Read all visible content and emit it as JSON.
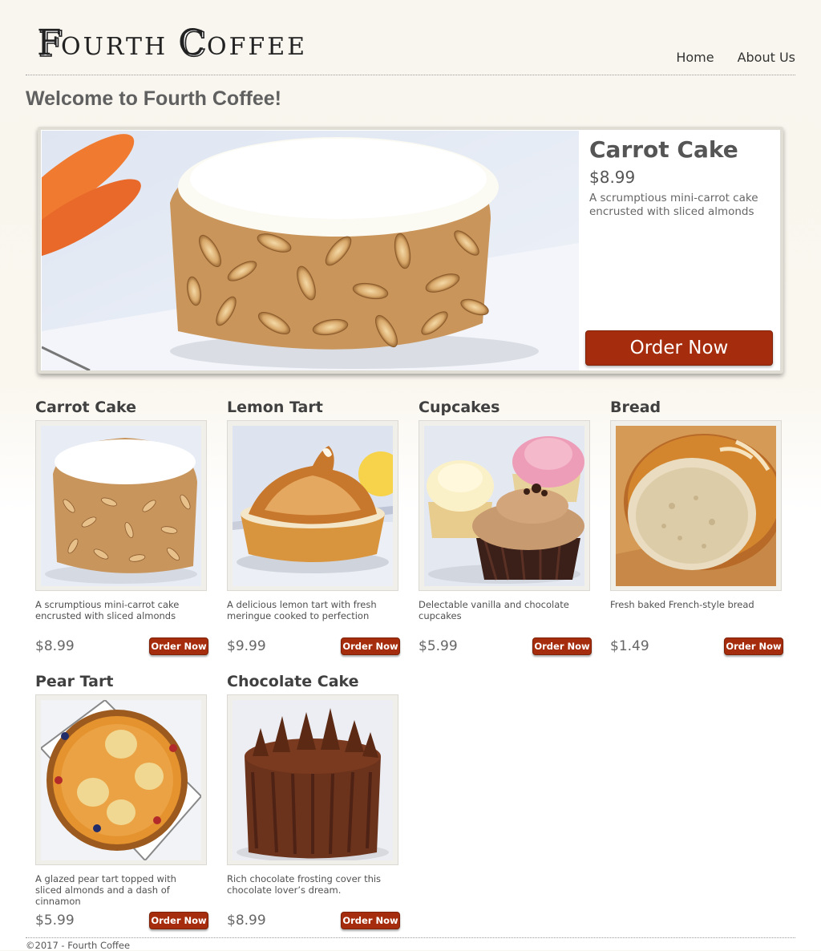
{
  "site": {
    "logo_text": "Fourth Coffee"
  },
  "nav": {
    "items": [
      {
        "label": "Home"
      },
      {
        "label": "About Us"
      }
    ]
  },
  "page": {
    "heading": "Welcome to Fourth Coffee!"
  },
  "featured": {
    "title": "Carrot Cake",
    "price": "$8.99",
    "description": "A scrumptious mini-carrot cake encrusted with sliced almonds",
    "order_label": "Order Now"
  },
  "products": [
    {
      "title": "Carrot Cake",
      "description": "A scrumptious mini-carrot cake encrusted with sliced almonds",
      "price": "$8.99",
      "order_label": "Order Now"
    },
    {
      "title": "Lemon Tart",
      "description": "A delicious lemon tart with fresh meringue cooked to perfection",
      "price": "$9.99",
      "order_label": "Order Now"
    },
    {
      "title": "Cupcakes",
      "description": "Delectable vanilla and chocolate cupcakes",
      "price": "$5.99",
      "order_label": "Order Now"
    },
    {
      "title": "Bread",
      "description": "Fresh baked French-style bread",
      "price": "$1.49",
      "order_label": "Order Now"
    },
    {
      "title": "Pear Tart",
      "description": "A glazed pear tart topped with sliced almonds and a dash of cinnamon",
      "price": "$5.99",
      "order_label": "Order Now"
    },
    {
      "title": "Chocolate Cake",
      "description": "Rich chocolate frosting cover this chocolate lover’s dream.",
      "price": "$8.99",
      "order_label": "Order Now"
    }
  ],
  "footer": {
    "text": "©2017 - Fourth Coffee"
  },
  "colors": {
    "accent": "#a52d0d",
    "background": "#f8f6ee",
    "text": "#505050"
  }
}
